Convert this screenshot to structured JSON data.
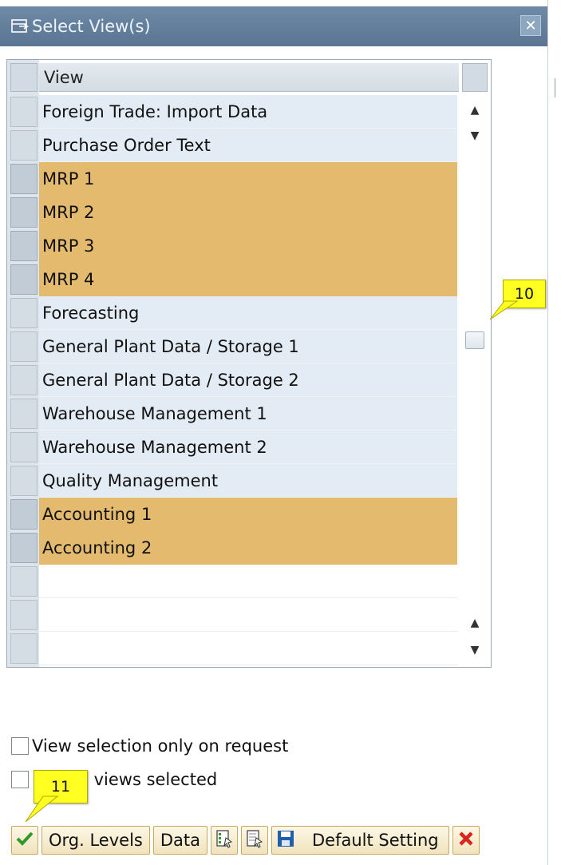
{
  "dialog": {
    "title": "Select View(s)",
    "close_glyph": "✕"
  },
  "table": {
    "header": "View",
    "rows": [
      {
        "label": "Foreign Trade: Import Data",
        "selected": false
      },
      {
        "label": "Purchase Order Text",
        "selected": false
      },
      {
        "label": "MRP 1",
        "selected": true
      },
      {
        "label": "MRP 2",
        "selected": true
      },
      {
        "label": "MRP 3",
        "selected": true
      },
      {
        "label": "MRP 4",
        "selected": true
      },
      {
        "label": "Forecasting",
        "selected": false
      },
      {
        "label": "General Plant Data / Storage 1",
        "selected": false
      },
      {
        "label": "General Plant Data / Storage 2",
        "selected": false
      },
      {
        "label": "Warehouse Management 1",
        "selected": false
      },
      {
        "label": "Warehouse Management 2",
        "selected": false
      },
      {
        "label": "Quality Management",
        "selected": false
      },
      {
        "label": "Accounting 1",
        "selected": true
      },
      {
        "label": "Accounting 2",
        "selected": true
      },
      {
        "label": "",
        "selected": false
      },
      {
        "label": "",
        "selected": false
      },
      {
        "label": "",
        "selected": false
      }
    ],
    "scroll_up_glyph": "▲",
    "scroll_down_glyph": "▼"
  },
  "options": {
    "view_selection_label": "View selection only on request",
    "views_selected_label": "e views selected"
  },
  "toolbar": {
    "org_levels_label": "Org. Levels",
    "data_label": "Data",
    "default_setting_label": "Default Setting"
  },
  "callouts": {
    "scroll_callout": "10",
    "toolbar_callout": "11"
  },
  "colors": {
    "selected_row": "#e4bb6e",
    "unselected_row": "#e3ecf4",
    "title_bar": "#6f8aa6",
    "callout": "#ffff22"
  },
  "icons": {
    "title": "window-icon",
    "confirm": "check-icon",
    "select_all": "select-all-icon",
    "deselect_all": "deselect-all-icon",
    "save": "save-icon",
    "cancel": "cancel-icon"
  }
}
